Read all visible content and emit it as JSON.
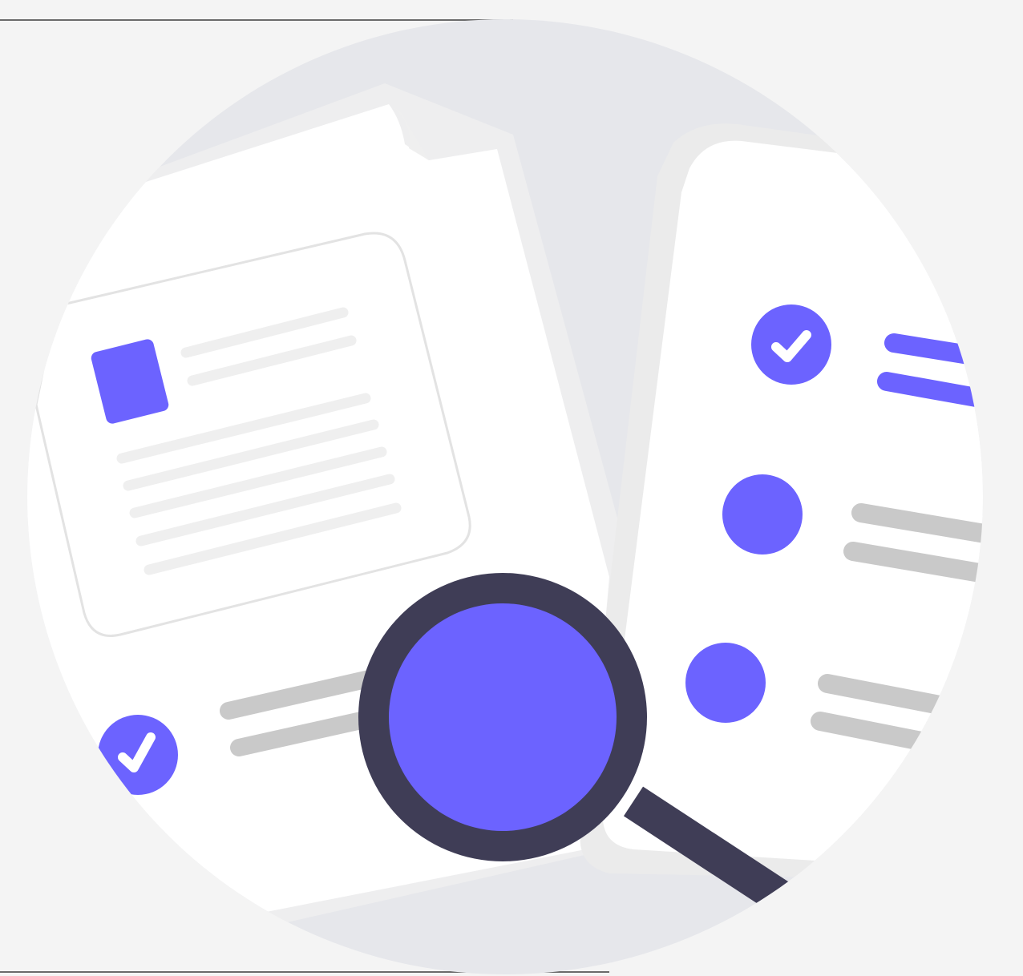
{
  "illustration": {
    "subject": "document-review-with-magnifier",
    "icons": [
      "document-card-icon",
      "checklist-phone-icon",
      "check-icon",
      "magnifying-glass-icon"
    ],
    "colors": {
      "background": "#f4f4f4",
      "circle": "#e6e7eb",
      "paper": "#ffffff",
      "paper_shadow": "#ececec",
      "text_line_light": "#efefef",
      "text_line_gray": "#c9c9c9",
      "accent": "#6c63ff",
      "magnifier_frame": "#3f3d56"
    },
    "checklist": [
      {
        "state": "checked"
      },
      {
        "state": "unchecked"
      },
      {
        "state": "unchecked"
      }
    ]
  }
}
